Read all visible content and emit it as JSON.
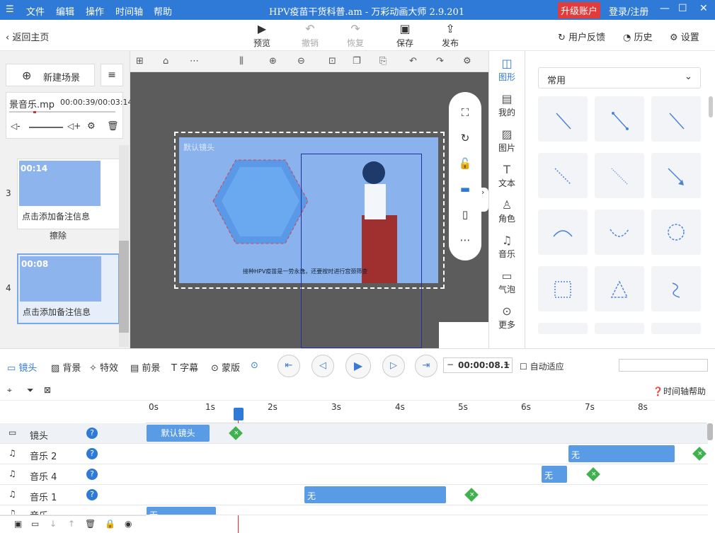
{
  "titlebar": {
    "menus": [
      "文件",
      "编辑",
      "操作",
      "时间轴",
      "帮助"
    ],
    "title": "HPV疫苗干货科普.am - 万彩动画大师 2.9.201",
    "upgrade": "升级账户",
    "login": "登录/注册"
  },
  "toolbar": {
    "back": "返回主页",
    "preview": "预览",
    "undo": "撤销",
    "redo": "恢复",
    "save": "保存",
    "publish": "发布",
    "feedback": "用户反馈",
    "history": "历史",
    "settings": "设置"
  },
  "left": {
    "new_scene": "新建场景",
    "music_name": "景音乐.mp",
    "music_time": "00:00:39/00:03:14",
    "scene3_time": "00:14",
    "scene3_note": "点击添加备注信息",
    "scene3_num": "3",
    "erase": "擦除",
    "scene4_time": "00:08",
    "scene4_note": "点击添加备注信息",
    "scene4_num": "4"
  },
  "canvas": {
    "cam_label": "默认镜头",
    "subtitle": "接种HPV疫苗是一劳永逸，还要按时进行宫颈筛查"
  },
  "categories": [
    {
      "icon": "shape-icon",
      "label": "图形"
    },
    {
      "icon": "mine-icon",
      "label": "我的"
    },
    {
      "icon": "image-icon",
      "label": "图片"
    },
    {
      "icon": "text-icon",
      "label": "文本"
    },
    {
      "icon": "role-icon",
      "label": "角色"
    },
    {
      "icon": "music-icon",
      "label": "音乐"
    },
    {
      "icon": "bubble-icon",
      "label": "气泡"
    },
    {
      "icon": "more-icon",
      "label": "更多"
    }
  ],
  "shapes": {
    "select": "常用"
  },
  "timeline": {
    "tabs": [
      "镜头",
      "背景",
      "特效",
      "前景",
      "字幕",
      "蒙版"
    ],
    "time": "00:00:08.1",
    "auto": "自动适应",
    "help": "时间轴帮助",
    "ruler": [
      "0s",
      "1s",
      "2s",
      "3s",
      "4s",
      "5s",
      "6s",
      "7s",
      "8s"
    ],
    "tracks": [
      {
        "label": "镜头",
        "clip": "默认镜头"
      },
      {
        "label": "音乐 2",
        "clip": "无"
      },
      {
        "label": "音乐 4",
        "clip": "无"
      },
      {
        "label": "音乐 1",
        "clip": "无"
      },
      {
        "label": "音乐",
        "clip": "无"
      }
    ]
  },
  "colors": {
    "accent": "#2f7ad6",
    "upgrade": "#e23b3b",
    "clip": "#5a9be6",
    "add": "#3fb24f"
  }
}
